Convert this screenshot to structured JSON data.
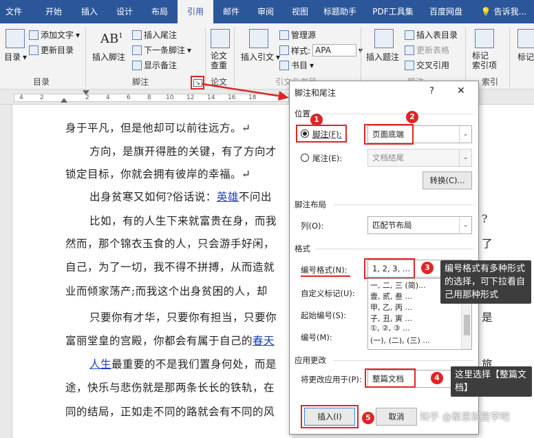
{
  "tabs": [
    "文件",
    "开始",
    "插入",
    "设计",
    "布局",
    "引用",
    "邮件",
    "审阅",
    "视图",
    "标题助手",
    "PDF工具集",
    "百度网盘",
    "告诉我..."
  ],
  "ribbon": {
    "toc_label": "目录",
    "add_text": "添加文字",
    "update_toc": "更新目录",
    "toc_group": "目录",
    "insert_footnote": "插入脚注",
    "insert_endnote": "插入尾注",
    "next_footnote": "下一条脚注",
    "show_notes": "显示备注",
    "footnote_group": "脚注",
    "paper_check": "论文\n查重",
    "paper_group": "论文",
    "insert_citation": "插入引文",
    "manage_sources": "管理源",
    "style_label": "样式:",
    "style_value": "APA",
    "bibliography": "书目",
    "citation_group": "引文与书目",
    "insert_caption": "插入题注",
    "insert_table_of_figures": "插入表目录",
    "update_table": "更新表格",
    "cross_reference": "交叉引用",
    "caption_group": "题注",
    "mark_entry": "标记\n索引项",
    "index_group": "索引",
    "mark_citation": "标记"
  },
  "ruler_numbers": [
    "4",
    "2",
    "2",
    "4",
    "6",
    "8",
    "10",
    "12",
    "14",
    "16",
    "18"
  ],
  "document": {
    "l1": "身于平凡，但是他却可以前往远方。↵",
    "l2": "方向，是旗开得胜的关键，有了方向才",
    "l3": "锁定目标，你就会拥有彼岸的幸福。↵",
    "l4a": "出身贫寒又如何?俗话说：",
    "l4b": "英雄",
    "l4c": "不问出",
    "l5": "比如，有的人生下来就富贵在身，而我",
    "l6": "然而，那个锦衣玉食的人，只会游手好闲，",
    "l7": "自己，为了一切，我不得不拼搏，从而造就",
    "l8": "业而倾家荡产;而我这个出身贫困的人，却",
    "l9": "只要你有才华，只要你有担当，只要你",
    "l10a": "富丽堂皇的宫殿，你都会有属于自己的",
    "l10b": "春天",
    "l11a": "人生",
    "l11b": "最重要的不是我们置身何处，而是",
    "l12": "途，快乐与悲伤就是那两条长长的铁轨，在",
    "l13": "同的结局，正如走不同的路就会有不同的风",
    "r5": "?",
    "r6": "了",
    "r9": "是",
    "r11": "旅"
  },
  "dialog": {
    "title": "脚注和尾注",
    "help": "?",
    "close": "✕",
    "location": "位置",
    "footnote_label": "脚注(F):",
    "footnote_value": "页面底端",
    "endnote_label": "尾注(E):",
    "endnote_value": "文档结尾",
    "convert": "转换(C)...",
    "layout": "脚注布局",
    "columns_label": "列(O):",
    "columns_value": "匹配节布局",
    "format": "格式",
    "number_format_label": "编号格式(N):",
    "number_format_value": "1, 2, 3, ...",
    "custom_mark_label": "自定义标记(U):",
    "start_at_label": "起始编号(S):",
    "numbering_label": "编号(M):",
    "options": [
      "一, 二, 三 (简)...",
      "壹, 贰, 叁 ...",
      "甲, 乙, 丙 ...",
      "子, 丑, 寅 ...",
      "①, ②, ③ ...",
      "(一), (二), (三) ..."
    ],
    "apply": "应用更改",
    "apply_to_label": "将更改应用于(P):",
    "apply_to_value": "整篇文档",
    "insert": "插入(I)",
    "cancel": "取消"
  },
  "callouts": {
    "c3": "编号格式有多种形式的选择，可下拉看自己用那种形式",
    "c4": "这里选择【整篇文档】"
  },
  "circles": [
    "1",
    "2",
    "3",
    "4",
    "5"
  ],
  "watermark": "知乎 @聚思就是学吧"
}
